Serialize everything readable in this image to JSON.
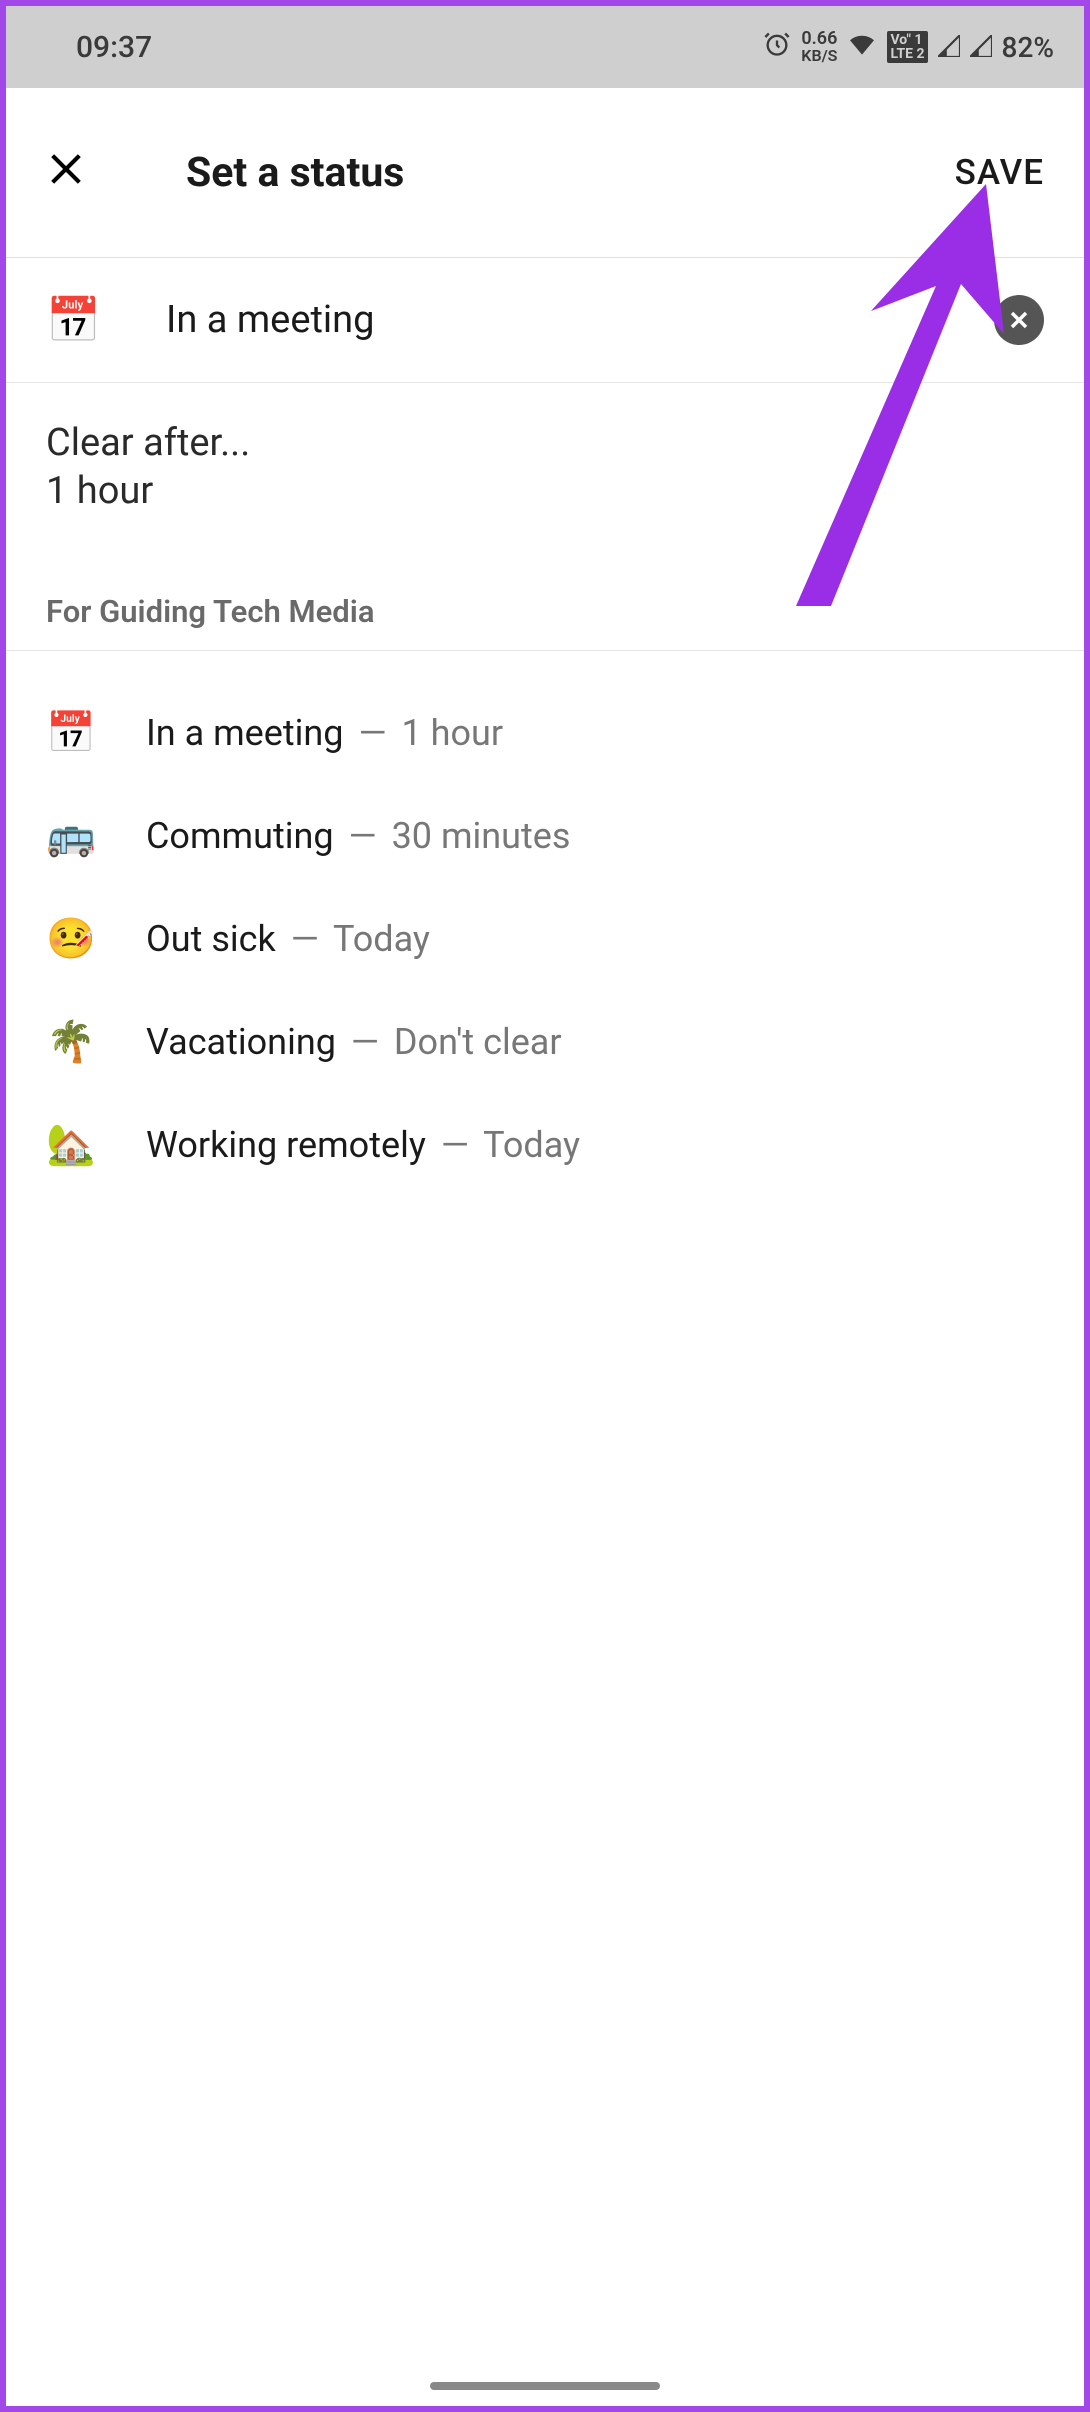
{
  "statusbar": {
    "time": "09:37",
    "data_rate_value": "0.66",
    "data_rate_unit": "KB/S",
    "lte_line1": "Vo\" 1",
    "lte_line2": "LTE 2",
    "battery": "82%"
  },
  "header": {
    "title": "Set a status",
    "save": "SAVE"
  },
  "current": {
    "emoji": "📅",
    "text": "In a meeting"
  },
  "clear_after": {
    "label": "Clear after...",
    "value": "1 hour"
  },
  "workspace_label": "For Guiding Tech Media",
  "presets": [
    {
      "emoji": "📅",
      "name": "In a meeting",
      "duration": "1 hour"
    },
    {
      "emoji": "🚌",
      "name": "Commuting",
      "duration": "30 minutes"
    },
    {
      "emoji": "🤒",
      "name": "Out sick",
      "duration": "Today"
    },
    {
      "emoji": "🌴",
      "name": "Vacationing",
      "duration": "Don't clear"
    },
    {
      "emoji": "🏡",
      "name": "Working remotely",
      "duration": "Today"
    }
  ],
  "colors": {
    "accent_arrow": "#9a2ee6",
    "border": "#a348e8"
  }
}
